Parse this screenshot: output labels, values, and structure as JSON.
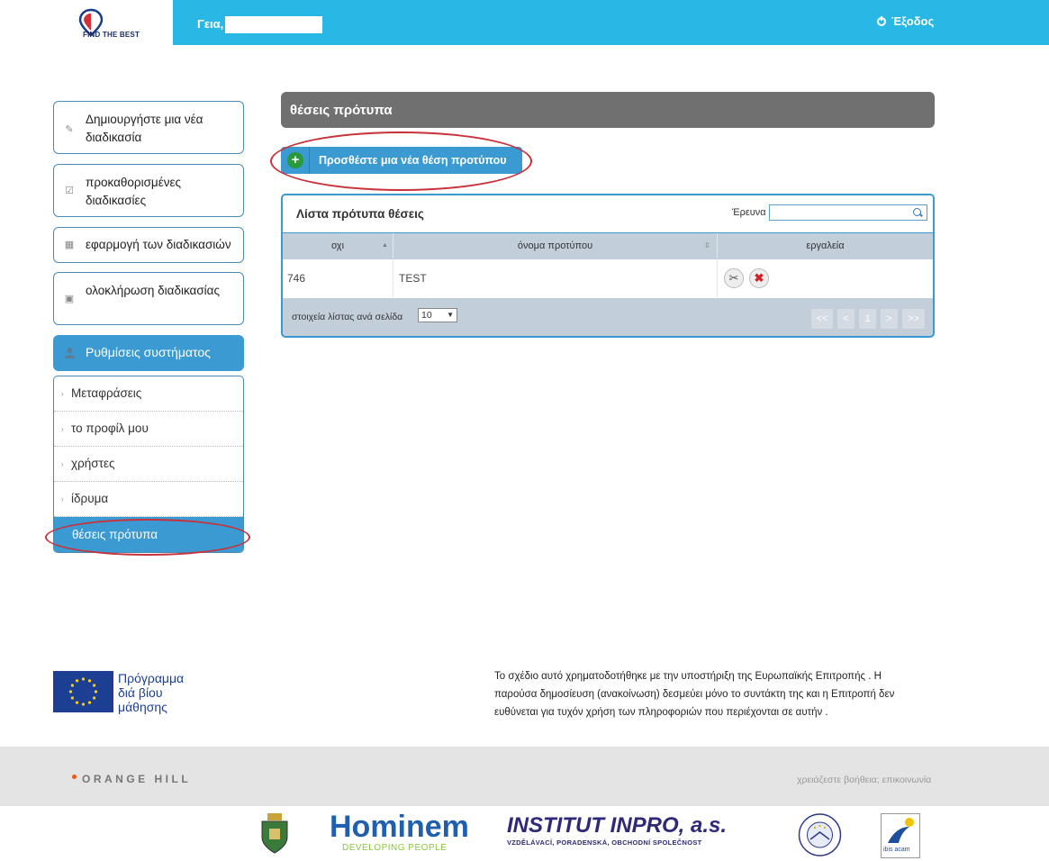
{
  "header": {
    "logo_text": "FIND THE BEST",
    "greeting": "Γεια,",
    "logout_label": "Έξοδος"
  },
  "sidebar": {
    "buttons": [
      {
        "label": "Δημιουργήστε μια νέα διαδικασία",
        "icon": "pencil-icon"
      },
      {
        "label": "προκαθορισμένες διαδικασίες",
        "icon": "edit-box-icon"
      },
      {
        "label": "εφαρμογή των διαδικασιών",
        "icon": "grid-icon"
      },
      {
        "label": "ολοκλήρωση διαδικασίας",
        "icon": "calendar-icon"
      }
    ],
    "settings_label": "Ρυθμίσεις συστήματος",
    "submenu": [
      {
        "label": "Μεταφράσεις"
      },
      {
        "label": "το προφίλ μου"
      },
      {
        "label": "χρήστες"
      },
      {
        "label": "ίδρυμα"
      },
      {
        "label": "θέσεις πρότυπα"
      }
    ]
  },
  "main": {
    "title": "θέσεις πρότυπα",
    "add_button": "Προσθέστε μια νέα θέση προτύπου",
    "panel_title": "Λίστα πρότυπα θέσεις",
    "search_label": "Έρευνα",
    "search_value": "",
    "columns": [
      "οχι",
      "όνομα προτύπου",
      "εργαλεία"
    ],
    "rows": [
      {
        "id": "746",
        "name": "TEST"
      }
    ],
    "per_page_label": "στοιχεία λίστας ανά σελίδα",
    "per_page_value": "10",
    "pagination": [
      "<<",
      "<",
      "1",
      ">",
      ">>"
    ]
  },
  "footer": {
    "eu_program": [
      "Πρόγραμμα",
      "διά βίου",
      "μάθησης"
    ],
    "notice": "Το σχέδιο αυτό χρηματοδοτήθηκε με την υποστήριξη της Ευρωπαϊκής Επιτροπής . Η παρούσα δημοσίευση (ανακοίνωση) δεσμεύει μόνο το συντάκτη της και η Επιτροπή δεν ευθύνεται για τυχόν χρήση των πληροφοριών που περιέχονται σε αυτήν .",
    "brand": "ORANGE HILL",
    "help": "χρειάζεστε βοήθεια; επικοινωνία",
    "partners": {
      "hominem": "Hominem",
      "hominem_sub": "DEVELOPING PEOPLE",
      "inpro": "INSTITUT INPRO, a.s.",
      "inpro_sub": "VZDĚLÁVACÍ, PORADENSKÁ, OBCHODNÍ SPOLEČNOST",
      "ibis": "ibis acam"
    }
  },
  "colors": {
    "header_blue": "#29b8e5",
    "accent_blue": "#3a9ad1",
    "title_gray": "#707070",
    "highlight_red": "#c8323a"
  }
}
